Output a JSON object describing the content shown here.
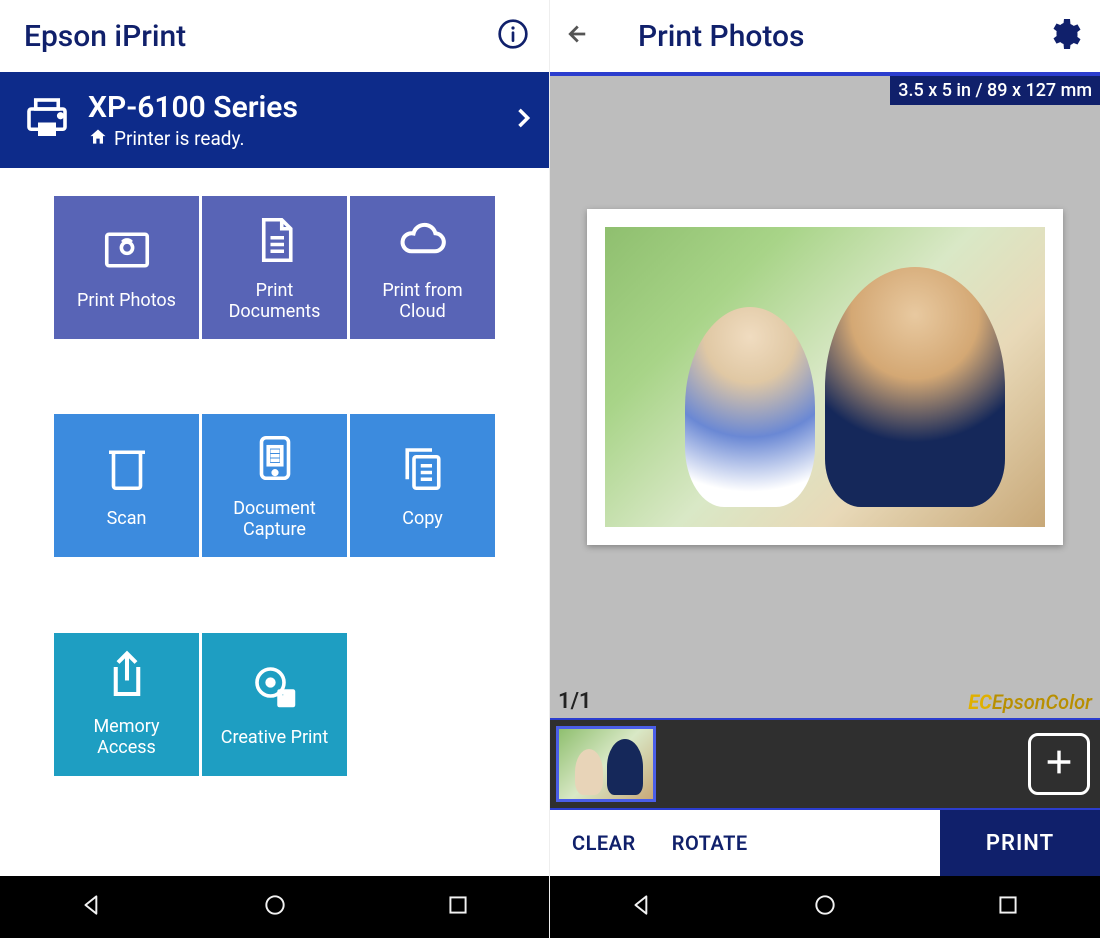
{
  "left": {
    "app_title": "Epson iPrint",
    "printer": {
      "model": "XP-6100 Series",
      "status": "Printer is ready."
    },
    "tiles": [
      {
        "label": "Print Photos",
        "icon": "photo-icon",
        "tone": "a"
      },
      {
        "label": "Print Documents",
        "icon": "document-icon",
        "tone": "a"
      },
      {
        "label": "Print from Cloud",
        "icon": "cloud-icon",
        "tone": "a"
      },
      {
        "label": "Scan",
        "icon": "scan-icon",
        "tone": "b"
      },
      {
        "label": "Document Capture",
        "icon": "capture-icon",
        "tone": "b"
      },
      {
        "label": "Copy",
        "icon": "copy-icon",
        "tone": "b"
      },
      {
        "label": "Memory Access",
        "icon": "memory-icon",
        "tone": "c"
      },
      {
        "label": "Creative Print",
        "icon": "creative-icon",
        "tone": "c"
      }
    ]
  },
  "right": {
    "title": "Print Photos",
    "size_badge": "3.5 x 5 in / 89 x 127 mm",
    "page_counter": "1/1",
    "color_brand": {
      "prefix": "EC",
      "mid": "Epson",
      "suffix": "Color"
    },
    "toolbar": {
      "clear": "CLEAR",
      "rotate": "ROTATE",
      "print": "PRINT"
    }
  }
}
